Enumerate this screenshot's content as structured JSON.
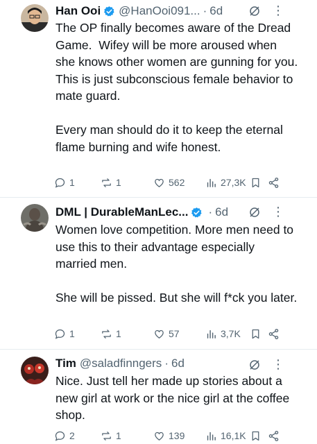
{
  "tweets": [
    {
      "name": "Han Ooi",
      "handle": "@HanOoi091...",
      "time": "6d",
      "text": "The OP finally becomes aware of the Dread Game.  Wifey will be more aroused when she knows other women are gunning for you.  This is just subconscious female behavior to mate guard.\n\nEvery man should do it to keep the eternal flame burning and wife honest.",
      "replies": "1",
      "reposts": "1",
      "likes": "562",
      "views": "27,3K"
    },
    {
      "name": "DML | DurableManLec...",
      "handle": "",
      "time": "6d",
      "text": "Women love competition. More men need to use this to their advantage especially married men.\n\nShe will be pissed. But she will f*ck you later.",
      "replies": "1",
      "reposts": "1",
      "likes": "57",
      "views": "3,7K"
    },
    {
      "name": "Tim",
      "handle": "@saladfinngers",
      "time": "6d",
      "text": "Nice. Just tell her made up stories about a new girl at work or the nice girl at the coffee shop.",
      "replies": "2",
      "reposts": "1",
      "likes": "139",
      "views": "16,1K"
    }
  ],
  "separator": "·",
  "colors": {
    "verified": "#1d9bf0",
    "secondary": "#536471",
    "divider": "#e6ecf0"
  },
  "icons": [
    "reply-icon",
    "repost-icon",
    "like-icon",
    "views-icon",
    "bookmark-icon",
    "share-icon",
    "grok-icon",
    "more-icon",
    "verified-badge-icon"
  ]
}
